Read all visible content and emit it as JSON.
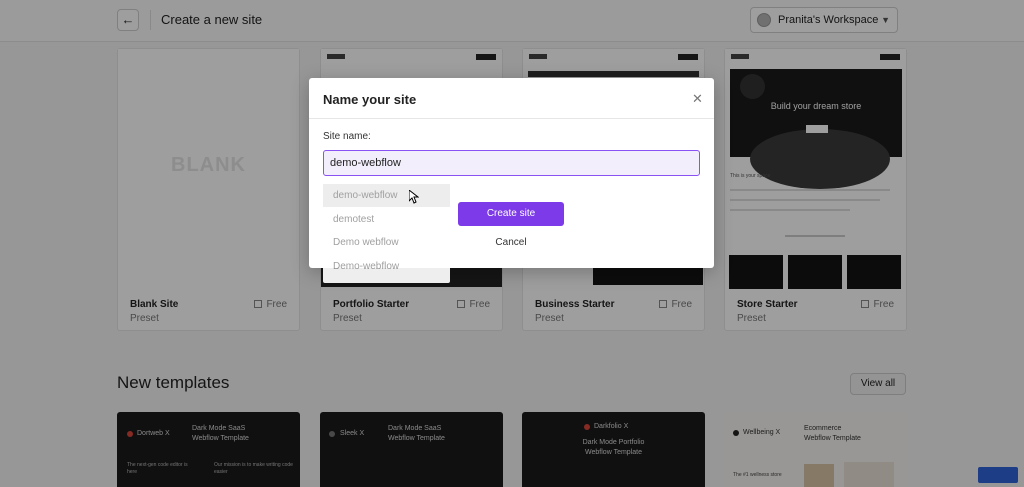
{
  "header": {
    "back_icon": "arrow-left-icon",
    "title": "Create a new site",
    "workspace": "Pranita's Workspace",
    "workspace_chevron": "chevron-down-icon"
  },
  "presets": [
    {
      "name": "Blank Site",
      "type": "Preset",
      "price": "Free",
      "thumb_text": "BLANK"
    },
    {
      "name": "Portfolio Starter",
      "type": "Preset",
      "price": "Free"
    },
    {
      "name": "Business Starter",
      "type": "Preset",
      "price": "Free"
    },
    {
      "name": "Store Starter",
      "type": "Preset",
      "price": "Free",
      "thumb_headline": "Build your dream store",
      "thumb_small": "This is your space"
    }
  ],
  "templates_section": {
    "title": "New templates",
    "view_all": "View all",
    "items": [
      {
        "logo": "Dortweb X",
        "headline": "Dark Mode SaaS\nWebflow Template",
        "small": "The next-gen code editor is here",
        "small2": "Our mission is to make writing code easier"
      },
      {
        "logo": "Sleek X",
        "headline": "Dark Mode SaaS\nWebflow Template"
      },
      {
        "logo": "Darkfolio X",
        "headline": "Dark Mode Portfolio\nWebflow Template"
      },
      {
        "logo": "Wellbeing X",
        "headline": "Ecommerce\nWebflow Template",
        "small": "The #1 wellness store"
      }
    ]
  },
  "modal": {
    "title": "Name your site",
    "close_icon": "close-icon",
    "field_label": "Site name:",
    "input_value": "demo-webflow",
    "create_label": "Create site",
    "cancel_label": "Cancel"
  },
  "autocomplete": [
    "demo-webflow",
    "demotest",
    "Demo webflow",
    "Demo-webflow"
  ],
  "colors": {
    "accent": "#7c3ae8",
    "input_bg": "#f2eefc",
    "input_border": "#8a52f3"
  }
}
